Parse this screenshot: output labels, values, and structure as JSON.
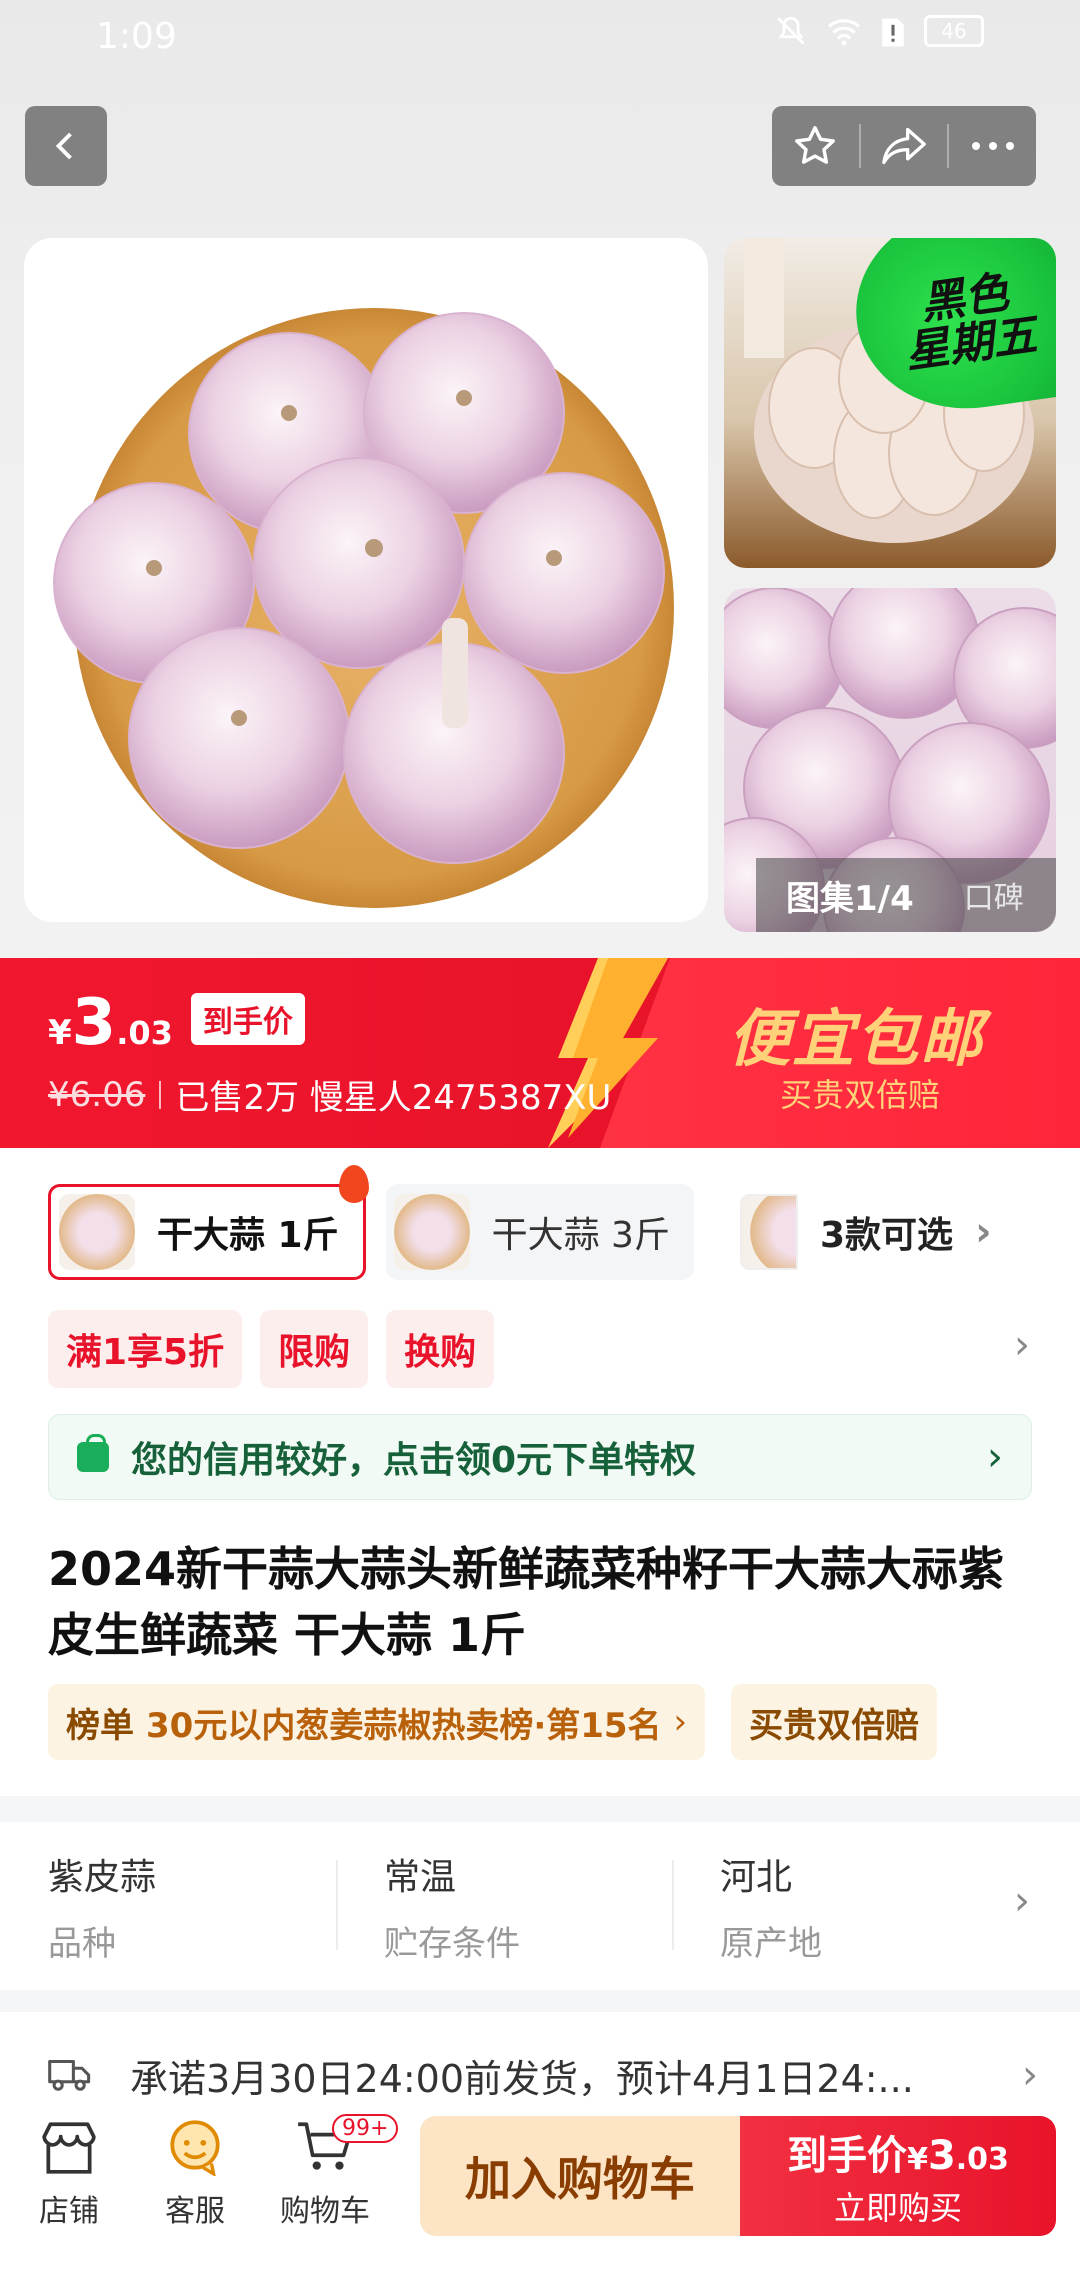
{
  "status": {
    "time": "1:09",
    "battery": "46"
  },
  "gallery": {
    "badge_line1": "黑色",
    "badge_line2": "星期五",
    "tab_gallery": "图集1/4",
    "tab_reviews": "口碑"
  },
  "price": {
    "currency": "¥",
    "int": "3",
    "dec": ".03",
    "final_tag": "到手价",
    "original": "¥6.06",
    "sold_info": "已售2万 慢星人2475387XU",
    "promo_title": "便宜包邮",
    "promo_sub": "买贵双倍赔"
  },
  "skus": [
    {
      "label": "干大蒜 1斤",
      "selected": true
    },
    {
      "label": "干大蒜 3斤",
      "selected": false
    }
  ],
  "sku_more": "3款可选",
  "promo_tags": [
    "满1享5折",
    "限购",
    "换购"
  ],
  "credit": "您的信用较好，点击领0元下单特权",
  "title": "2024新干蒜大蒜头新鲜蔬菜种籽干大蒜大祘紫皮生鲜蔬菜 干大蒜 1斤",
  "rank": {
    "label": "榜单",
    "value": "30元以内葱姜蒜椒热卖榜·第15名",
    "guarantee": "买贵双倍赔"
  },
  "attributes": [
    {
      "value": "紫皮蒜",
      "key": "品种"
    },
    {
      "value": "常温",
      "key": "贮存条件"
    },
    {
      "value": "河北",
      "key": "原产地"
    }
  ],
  "shipping": "承诺3月30日24:00前发货，预计4月1日24:...",
  "bottom": {
    "shop": "店铺",
    "service": "客服",
    "cart": "购物车",
    "cart_badge": "99+",
    "add_cart": "加入购物车",
    "buy_l1": "到手价",
    "buy_price_cur": "¥",
    "buy_price_int": "3",
    "buy_price_dec": ".03",
    "buy_l2": "立即购买"
  },
  "colors": {
    "accent": "#e8132a",
    "promo_gold": "#ffd27a",
    "credit_green": "#1aae5a"
  }
}
